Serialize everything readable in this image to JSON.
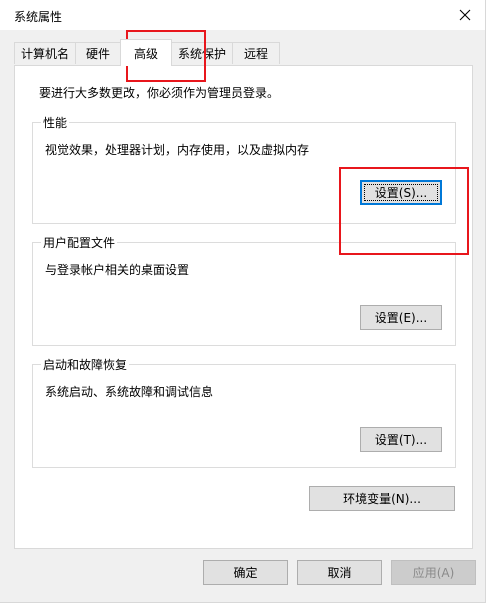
{
  "window": {
    "title": "系统属性"
  },
  "tabs": [
    {
      "label": "计算机名"
    },
    {
      "label": "硬件"
    },
    {
      "label": "高级"
    },
    {
      "label": "系统保护"
    },
    {
      "label": "远程"
    }
  ],
  "notice": "要进行大多数更改，你必须作为管理员登录。",
  "performance": {
    "title": "性能",
    "description": "视觉效果，处理器计划，内存使用，以及虚拟内存",
    "button": "设置(S)..."
  },
  "user_profiles": {
    "title": "用户配置文件",
    "description": "与登录帐户相关的桌面设置",
    "button": "设置(E)..."
  },
  "startup_recovery": {
    "title": "启动和故障恢复",
    "description": "系统启动、系统故障和调试信息",
    "button": "设置(T)..."
  },
  "env_button": "环境变量(N)...",
  "footer": {
    "ok": "确定",
    "cancel": "取消",
    "apply": "应用(A)"
  },
  "colors": {
    "annotation_red": "#e8161c",
    "focus_blue": "#0078d7"
  }
}
